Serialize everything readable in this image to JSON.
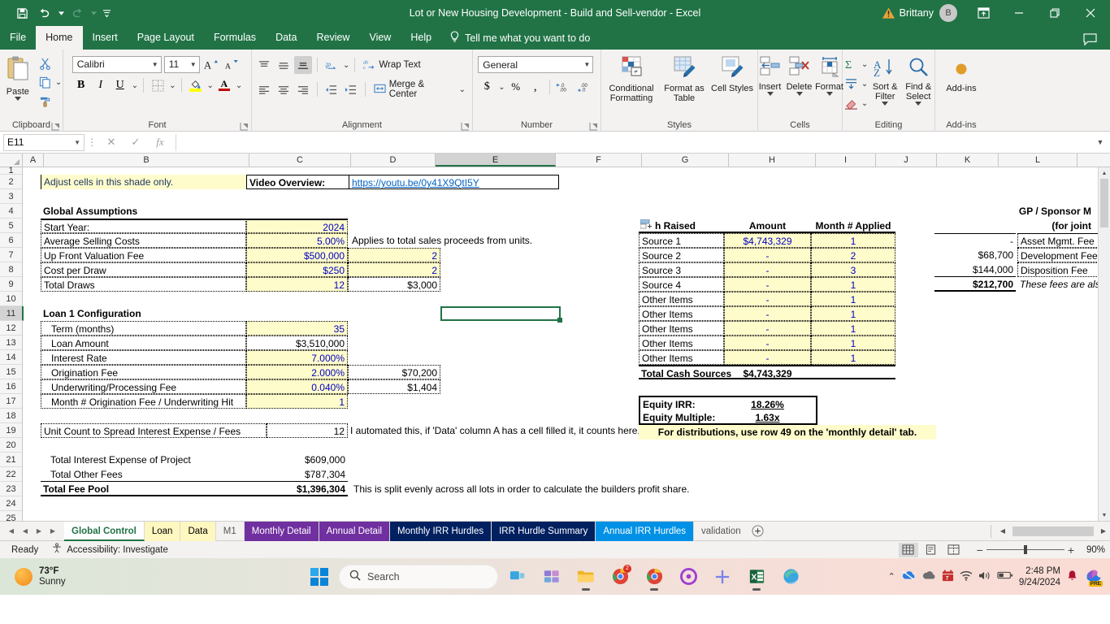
{
  "window": {
    "title": "Lot or New Housing Development - Build and Sell-vendor  -  Excel",
    "user_name": "Brittany",
    "user_initial": "B",
    "qat": [
      "save-icon",
      "undo-icon",
      "redo-icon",
      "customize-icon"
    ],
    "controls": [
      "ribbon-display-icon",
      "minimize-icon",
      "restore-icon",
      "close-icon"
    ]
  },
  "ribbon": {
    "tabs": [
      "File",
      "Home",
      "Insert",
      "Page Layout",
      "Formulas",
      "Data",
      "Review",
      "View",
      "Help"
    ],
    "active_tab": "Home",
    "tellme": "Tell me what you want to do",
    "groups": {
      "clipboard": {
        "label": "Clipboard",
        "paste": "Paste",
        "items": [
          "cut-icon",
          "copy-icon",
          "format-painter-icon"
        ]
      },
      "font": {
        "label": "Font",
        "font_name": "Calibri",
        "font_size": "11",
        "buttons": [
          "grow-font-icon",
          "shrink-font-icon",
          "bold-icon",
          "italic-icon",
          "underline-icon",
          "borders-icon",
          "fill-color-icon",
          "font-color-icon"
        ]
      },
      "alignment": {
        "label": "Alignment",
        "wrap_text": "Wrap Text",
        "merge_center": "Merge & Center"
      },
      "number": {
        "label": "Number",
        "format": "General",
        "buttons": [
          "currency-icon",
          "percent-icon",
          "comma-icon",
          "increase-decimal-icon",
          "decrease-decimal-icon"
        ]
      },
      "styles": {
        "label": "Styles",
        "conditional_formatting": "Conditional Formatting",
        "format_as_table": "Format as Table",
        "cell_styles": "Cell Styles"
      },
      "cells": {
        "label": "Cells",
        "insert": "Insert",
        "delete": "Delete",
        "format": "Format"
      },
      "editing": {
        "label": "Editing",
        "sort_filter": "Sort & Filter",
        "find_select": "Find & Select"
      },
      "addins": {
        "label": "Add-ins",
        "button": "Add-ins"
      }
    }
  },
  "formula_bar": {
    "name_box": "E11",
    "formula": "",
    "buttons": [
      "cancel-icon",
      "enter-icon",
      "insert-function-icon"
    ]
  },
  "grid": {
    "columns": [
      "A",
      "B",
      "C",
      "D",
      "E",
      "F",
      "G",
      "H",
      "I",
      "J",
      "K",
      "L"
    ],
    "selected_column": "E",
    "rows": [
      "1",
      "2",
      "3",
      "4",
      "5",
      "6",
      "7",
      "8",
      "9",
      "10",
      "11",
      "12",
      "13",
      "14",
      "15",
      "16",
      "17",
      "18",
      "19",
      "20",
      "21",
      "22",
      "23",
      "24",
      "25"
    ],
    "selected_row": "11",
    "selected_cell": "E11",
    "notes": {
      "shade_note": "Adjust cells in this shade only.",
      "video_label": "Video Overview:",
      "video_url": "https://youtu.be/0y41X9QtI5Y"
    },
    "global_assumptions": {
      "title": "Global Assumptions",
      "rows": [
        {
          "label": "Start Year:",
          "value": "2024",
          "extra": "",
          "note": ""
        },
        {
          "label": "Average Selling Costs",
          "value": "5.00%",
          "extra": "",
          "note": "Applies to total sales proceeds from units."
        },
        {
          "label": "Up Front Valuation Fee",
          "value": "$500,000",
          "extra": "2",
          "note": ""
        },
        {
          "label": "Cost per Draw",
          "value": "$250",
          "extra": "2",
          "note": ""
        },
        {
          "label": "Total Draws",
          "value": "12",
          "extra": "$3,000",
          "note": ""
        }
      ]
    },
    "loan_config": {
      "title": "Loan 1 Configuration",
      "rows": [
        {
          "label": "Term (months)",
          "value": "35",
          "extra": ""
        },
        {
          "label": "Loan Amount",
          "value": "$3,510,000",
          "extra": ""
        },
        {
          "label": "Interest Rate",
          "value": "7.000%",
          "extra": ""
        },
        {
          "label": "Origination Fee",
          "value": "2.000%",
          "extra": "$70,200"
        },
        {
          "label": "Underwriting/Processing Fee",
          "value": "0.040%",
          "extra": "$1,404"
        },
        {
          "label": "Month # Origination Fee / Underwriting Hit",
          "value": "1",
          "extra": ""
        }
      ]
    },
    "unit_count": {
      "label": "Unit Count to Spread Interest Expense / Fees",
      "value": "12",
      "note": "I automated this, if 'Data' column A has a cell filled it, it counts here. That should scale as you add lots automatically."
    },
    "fee_pool": {
      "rows": [
        {
          "label": "Total Interest Expense of Project",
          "value": "$609,000"
        },
        {
          "label": "Total Other Fees",
          "value": "$787,304"
        }
      ],
      "total_label": "Total Fee Pool",
      "total_value": "$1,396,304",
      "note": "This is split evenly across all lots in order to calculate the builders profit share."
    },
    "cash_sources": {
      "headers": [
        "h Raised",
        "Amount",
        "Month # Applied"
      ],
      "rows": [
        {
          "label": "Source 1",
          "amount": "$4,743,329",
          "month": "1"
        },
        {
          "label": "Source 2",
          "amount": "-",
          "month": "2"
        },
        {
          "label": "Source 3",
          "amount": "-",
          "month": "3"
        },
        {
          "label": "Source 4",
          "amount": "-",
          "month": "1"
        },
        {
          "label": "Other Items",
          "amount": "-",
          "month": "1"
        },
        {
          "label": "Other Items",
          "amount": "-",
          "month": "1"
        },
        {
          "label": "Other Items",
          "amount": "-",
          "month": "1"
        },
        {
          "label": "Other Items",
          "amount": "-",
          "month": "1"
        },
        {
          "label": "Other Items",
          "amount": "-",
          "month": "1"
        }
      ],
      "total_label": "Total Cash Sources",
      "total_value": "$4,743,329"
    },
    "returns": {
      "irr_label": "Equity IRR:",
      "irr_value": "18.26%",
      "multiple_label": "Equity Multiple:",
      "multiple_value": "1.63x",
      "distribution_note": "For distributions, use row 49 on the 'monthly detail' tab."
    },
    "gp_sponsor": {
      "title_line1": "GP / Sponsor M",
      "title_line2": "(for joint",
      "rows": [
        {
          "value": "-",
          "label": "Asset Mgmt. Fee"
        },
        {
          "value": "$68,700",
          "label": "Development Fee"
        },
        {
          "value": "$144,000",
          "label": "Disposition Fee"
        }
      ],
      "total_value": "$212,700",
      "total_note": "These fees are als"
    }
  },
  "sheet_tabs": {
    "tabs": [
      {
        "label": "Global Control",
        "color": "#ffffff",
        "text": "#217346",
        "active": true
      },
      {
        "label": "Loan",
        "color": "#fff7c0",
        "text": "#1d1d1d",
        "active": false
      },
      {
        "label": "Data",
        "color": "#fff7c0",
        "text": "#1d1d1d",
        "active": false
      },
      {
        "label": "M1",
        "color": "#f3f2f1",
        "text": "#555555",
        "active": false
      },
      {
        "label": "Monthly Detail",
        "color": "#7030a0",
        "text": "#ffffff",
        "active": false
      },
      {
        "label": "Annual Detail",
        "color": "#7030a0",
        "text": "#ffffff",
        "active": false
      },
      {
        "label": "Monthly IRR Hurdles",
        "color": "#002060",
        "text": "#ffffff",
        "active": false
      },
      {
        "label": "IRR Hurdle Summary",
        "color": "#002060",
        "text": "#ffffff",
        "active": false
      },
      {
        "label": "Annual IRR Hurdles",
        "color": "#0091e6",
        "text": "#ffffff",
        "active": false
      },
      {
        "label": "validation",
        "color": "#f3f2f1",
        "text": "#555555",
        "active": false
      }
    ],
    "add_sheet": "add-sheet-icon"
  },
  "status_bar": {
    "state": "Ready",
    "accessibility": "Accessibility: Investigate",
    "views": [
      "normal-view-icon",
      "page-layout-icon",
      "page-break-icon"
    ],
    "zoom": "90%"
  },
  "taskbar": {
    "weather_temp": "73°F",
    "weather_cond": "Sunny",
    "search_placeholder": "Search",
    "apps": [
      "task-view-icon",
      "widgets-icon",
      "chat-icon",
      "file-explorer-icon",
      "chrome-icon",
      "chrome2-icon",
      "circle-app-icon",
      "teams-icon",
      "excel-icon",
      "edge-icon"
    ],
    "tray_icons": [
      "show-hidden-icon",
      "onedrive-icon",
      "cloud-icon",
      "calendar-red-icon",
      "wifi-icon",
      "volume-icon",
      "battery-icon"
    ],
    "time": "2:48 PM",
    "date": "9/24/2024",
    "notification": "bell-icon",
    "copilot": "copilot-icon"
  }
}
